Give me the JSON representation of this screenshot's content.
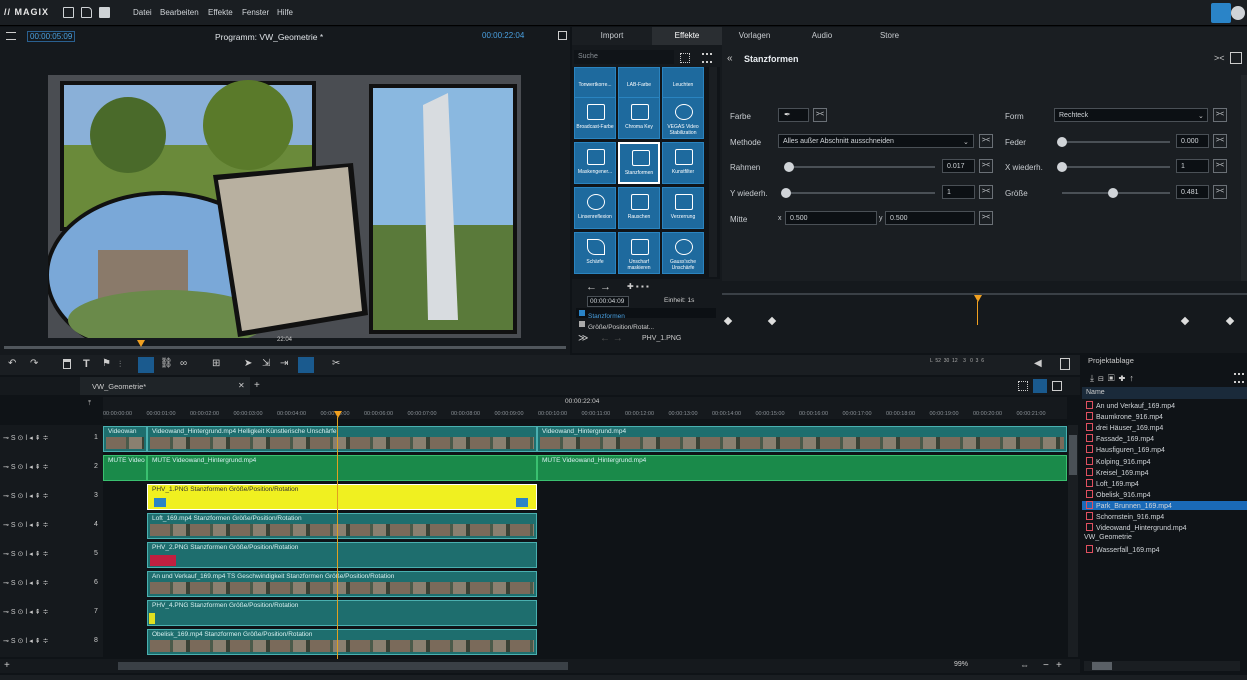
{
  "menubar": {
    "logo": "// MAGIX",
    "menus": [
      "Datei",
      "Bearbeiten",
      "Effekte",
      "Fenster",
      "Hilfe"
    ]
  },
  "preview": {
    "timecode_left": "00:00:05:09",
    "title": "Programm: VW_Geometrie *",
    "timecode_right": "00:00:22:04",
    "scrub_time": "22:04"
  },
  "tabs": [
    "Import",
    "Effekte",
    "Vorlagen",
    "Audio",
    "Store"
  ],
  "effects": {
    "search_placeholder": "Suche",
    "items": [
      [
        "Tonwertkorre...",
        "LAB-Farbe",
        "Leuchten"
      ],
      [
        "Broadcast-Farbe",
        "Chroma Key",
        "VEGAS Video Stabilization"
      ],
      [
        "Maskengener...",
        "Stanzformen",
        "Kunstfilter"
      ],
      [
        "Linsenreflexion",
        "Rauschen",
        "Verzerrung"
      ],
      [
        "Schärfe",
        "Unscharf maskieren",
        "Gauss'sche Unschärfe"
      ]
    ],
    "keyframe_time": "00:00:04:09",
    "einheit": "Einheit: 1s",
    "kf_rows": [
      "Stanzformen",
      "Größe/Position/Rotat..."
    ],
    "footer_file": "PHV_1.PNG"
  },
  "params": {
    "title": "Stanzformen",
    "farbe_label": "Farbe",
    "methode_label": "Methode",
    "methode_value": "Alles außer Abschnitt ausschneiden",
    "rahmen_label": "Rahmen",
    "rahmen_value": "0.017",
    "ywieder_label": "Y wiederh.",
    "ywieder_value": "1",
    "mitte_label": "Mitte",
    "mitte_x_label": "x",
    "mitte_x": "0.500",
    "mitte_y_label": "y",
    "mitte_y": "0.500",
    "form_label": "Form",
    "form_value": "Rechteck",
    "feder_label": "Feder",
    "feder_value": "0.000",
    "xwieder_label": "X wiederh.",
    "xwieder_value": "1",
    "groesse_label": "Größe",
    "groesse_value": "0.481"
  },
  "timeline": {
    "tab_name": "VW_Geometrie*",
    "ruler_time": "00:00:22:04",
    "ruler_marks": [
      "00:00:00:00",
      "00:00:01:00",
      "00:00:02:00",
      "00:00:03:00",
      "00:00:04:00",
      "00:00:05:00",
      "00:00:06:00",
      "00:00:07:00",
      "00:00:08:00",
      "00:00:09:00",
      "00:00:10:00",
      "00:00:11:00",
      "00:00:12:00",
      "00:00:13:00",
      "00:00:14:00",
      "00:00:15:00",
      "00:00:16:00",
      "00:00:17:00",
      "00:00:18:00",
      "00:00:19:00",
      "00:00:20:00",
      "00:00:21:00"
    ],
    "meter_labels": "L  52  30  12    3   0  3  6",
    "zoom": "99%",
    "tracks": [
      {
        "num": "1",
        "clips": [
          "Videowan",
          "Videowand_Hintergrund.mp4  Helligkeit  Künstlerische Unschärfe",
          "Videowand_Hintergrund.mp4"
        ]
      },
      {
        "num": "2",
        "clips": [
          "MUTE  Video",
          "MUTE  Videowand_Hintergrund.mp4",
          "MUTE  Videowand_Hintergrund.mp4"
        ]
      },
      {
        "num": "3",
        "clips": [
          "PHV_1.PNG  Stanzformen  Größe/Position/Rotation"
        ]
      },
      {
        "num": "4",
        "clips": [
          "Loft_169.mp4  Stanzformen  Größe/Position/Rotation"
        ]
      },
      {
        "num": "5",
        "clips": [
          "PHV_2.PNG  Stanzformen  Größe/Position/Rotation"
        ]
      },
      {
        "num": "6",
        "clips": [
          "An und Verkauf_169.mp4  TS  Geschwindigkeit  Stanzformen  Größe/Position/Rotation"
        ]
      },
      {
        "num": "7",
        "clips": [
          "PHV_4.PNG  Stanzformen  Größe/Position/Rotation"
        ]
      },
      {
        "num": "8",
        "clips": [
          "Obelisk_169.mp4  Stanzformen  Größe/Position/Rotation"
        ]
      }
    ]
  },
  "project": {
    "title": "Projektablage",
    "column": "Name",
    "items": [
      "An und Verkauf_169.mp4",
      "Baumkrone_916.mp4",
      "drei Häuser_169.mp4",
      "Fassade_169.mp4",
      "Hausfiguren_169.mp4",
      "Kolping_916.mp4",
      "Kreisel_169.mp4",
      "Loft_169.mp4",
      "Obelisk_916.mp4",
      "Park_Brunnen_169.mp4",
      "Schornstein_916.mp4",
      "Videowand_Hintergrund.mp4"
    ],
    "folder": "VW_Geometrie",
    "folder_items": [
      "Wasserfall_169.mp4"
    ],
    "selected": "Park_Brunnen_169.mp4"
  }
}
